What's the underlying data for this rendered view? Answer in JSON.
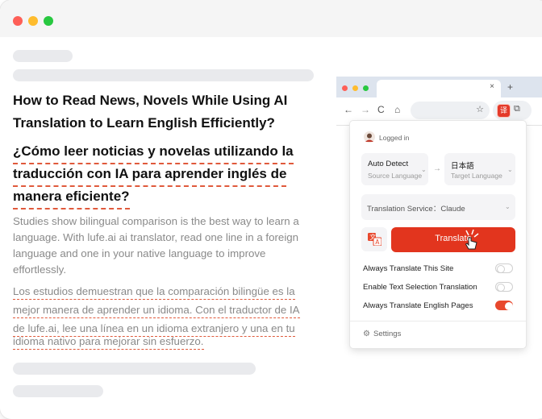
{
  "article": {
    "title_en": [
      "How to Read News, Novels While Using AI",
      "Translation to Learn English Efficiently?"
    ],
    "title_es": [
      "¿Cómo leer noticias y novelas utilizando la",
      "traducción con IA para aprender inglés de",
      "manera eficiente?"
    ],
    "body_en": [
      "Studies show bilingual comparison is the best way to learn a",
      "language. With lufe.ai ai translator, read one line in a foreign",
      "language and one in your native language to improve",
      "effortlessly."
    ],
    "body_es": [
      "Los estudios demuestran que la comparación bilingüe es la",
      "mejor manera de aprender un idioma. Con el traductor de IA",
      "de lufe.ai, lee una línea en un idioma extranjero y una en tu",
      "idioma nativo para mejorar sin esfuerzo."
    ]
  },
  "browser": {
    "tab_close": "×",
    "new_tab": "+",
    "nav": {
      "back": "←",
      "forward": "→",
      "reload": "C",
      "home": "⌂"
    }
  },
  "popup": {
    "status": "Logged in",
    "source": {
      "value": "Auto Detect",
      "label": "Source Language"
    },
    "target": {
      "value": "日本語",
      "label": "Target Language"
    },
    "service_label": "Translation Service：Claude",
    "translate_button": "Translate",
    "toggles": [
      {
        "label": "Always Translate This Site",
        "on": false
      },
      {
        "label": "Enable Text Selection Translation",
        "on": false
      },
      {
        "label": "Always Translate English Pages",
        "on": true
      }
    ],
    "settings": "Settings"
  },
  "colors": {
    "accent": "#e43a2a",
    "dashed_underline": "#e05a3c",
    "dot_red": "#fe5f57",
    "dot_yellow": "#febc2e",
    "dot_green": "#28c840"
  }
}
